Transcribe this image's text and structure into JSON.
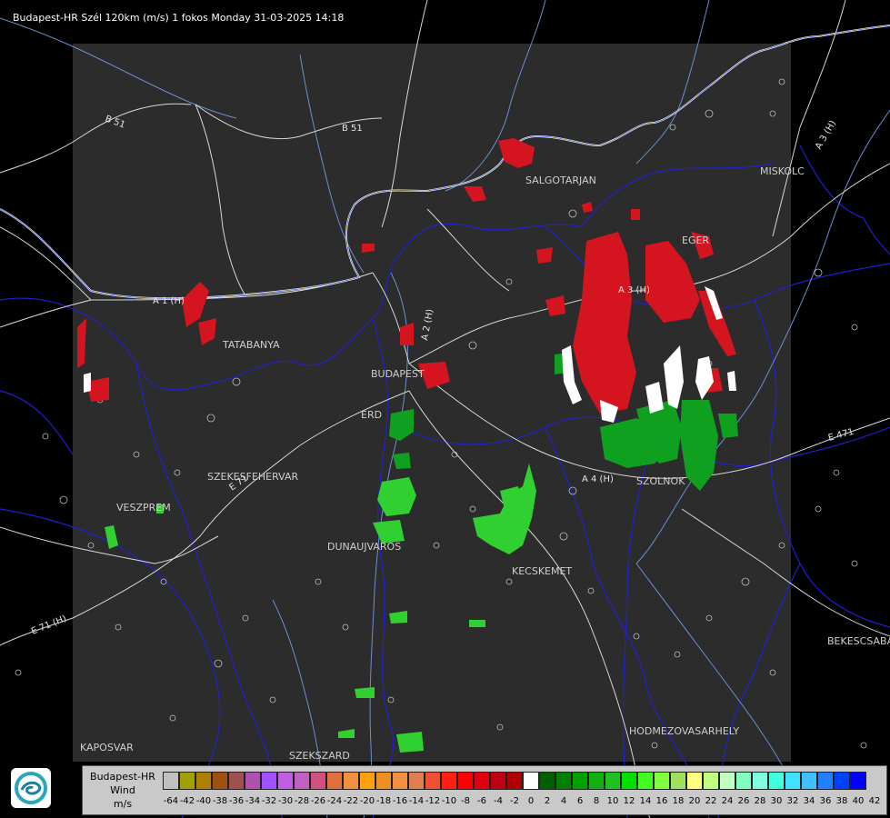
{
  "header": {
    "title": "Budapest-HR Szél 120km (m/s) 1 fokos Monday 31-03-2025 14:18"
  },
  "cities": [
    {
      "name": "SALGOTARJAN"
    },
    {
      "name": "MISKOLC"
    },
    {
      "name": "EGER"
    },
    {
      "name": "TATABANYA"
    },
    {
      "name": "BUDAPEST"
    },
    {
      "name": "ERD"
    },
    {
      "name": "SZEKESFEHERVAR"
    },
    {
      "name": "VESZPREM"
    },
    {
      "name": "DUNAUJVAROS"
    },
    {
      "name": "KECSKEMET"
    },
    {
      "name": "SZOLNOK"
    },
    {
      "name": "BEKESCSABA"
    },
    {
      "name": "HODMEZOVASARHELY"
    },
    {
      "name": "KAPOSVAR"
    },
    {
      "name": "SZEKSZARD"
    }
  ],
  "roads": [
    {
      "name": "B 51"
    },
    {
      "name": "B 51"
    },
    {
      "name": "A 1 (H)"
    },
    {
      "name": "A 2 (H)"
    },
    {
      "name": "A 3 (H)"
    },
    {
      "name": "A 3 (H)"
    },
    {
      "name": "A 4 (H)"
    },
    {
      "name": "E 71"
    },
    {
      "name": "E 71 (H)"
    },
    {
      "name": "E 471"
    }
  ],
  "legend": {
    "line1": "Budapest-HR",
    "line2": "Wind",
    "line3": "m/s",
    "ticks": [
      "-64",
      "-42",
      "-40",
      "-38",
      "-36",
      "-34",
      "-32",
      "-30",
      "-28",
      "-26",
      "-24",
      "-22",
      "-20",
      "-18",
      "-16",
      "-14",
      "-12",
      "-10",
      "-8",
      "-6",
      "-4",
      "-2",
      "0",
      "2",
      "4",
      "6",
      "8",
      "10",
      "12",
      "14",
      "16",
      "18",
      "20",
      "22",
      "24",
      "26",
      "28",
      "30",
      "32",
      "34",
      "36",
      "38",
      "40",
      "42"
    ],
    "colors": [
      "#c0c0c0",
      "#a0a000",
      "#b08000",
      "#a05010",
      "#a05050",
      "#b050b0",
      "#a050ff",
      "#c060e0",
      "#c060c0",
      "#d05080",
      "#e07040",
      "#f09040",
      "#ffa010",
      "#f09020",
      "#f09040",
      "#e08050",
      "#f05030",
      "#ff2010",
      "#ff0000",
      "#e00010",
      "#c00010",
      "#b00000",
      "#ffffff",
      "#006000",
      "#008000",
      "#00a000",
      "#10b010",
      "#20c020",
      "#00e000",
      "#40ff20",
      "#80ff40",
      "#a0e060",
      "#ffff80",
      "#c0ff80",
      "#c0ffc0",
      "#80ffc0",
      "#80ffe0",
      "#40ffe0",
      "#40e0ff",
      "#40c0ff",
      "#2080ff",
      "#0040ff",
      "#0000ff"
    ]
  }
}
